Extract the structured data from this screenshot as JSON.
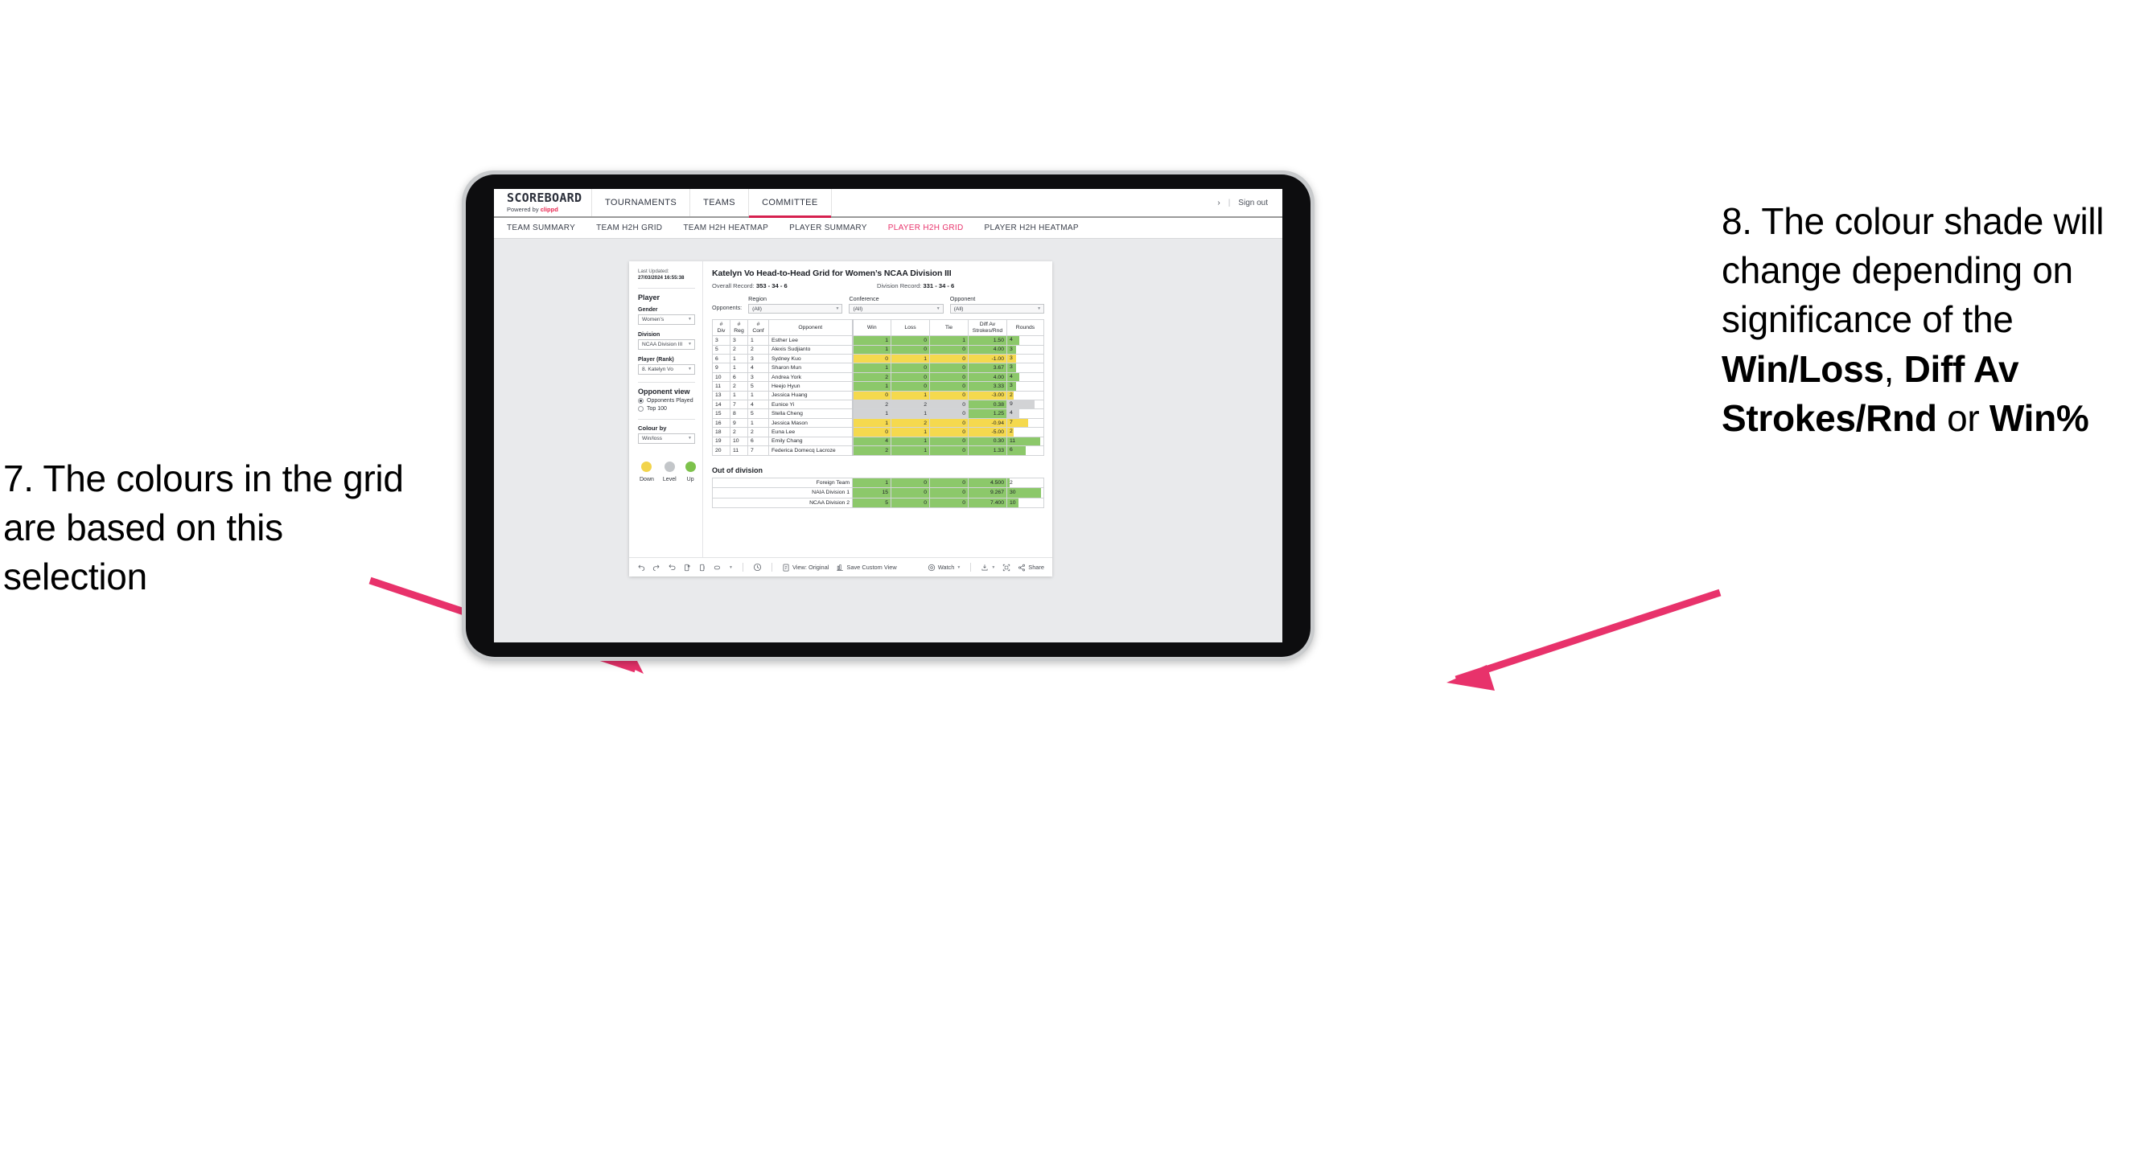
{
  "annotations": {
    "left": "7. The colours in the grid are based on this selection",
    "right_pre": "8. The colour shade will change depending on significance of the ",
    "right_b1": "Win/Loss",
    "right_mid1": ", ",
    "right_b2": "Diff Av Strokes/Rnd",
    "right_mid2": " or ",
    "right_b3": "Win%",
    "arrow_color": "#E8326B"
  },
  "app": {
    "brand": {
      "title": "SCOREBOARD",
      "powered": "Powered by",
      "by": "clippd"
    },
    "topnav": [
      {
        "label": "TOURNAMENTS",
        "active": false
      },
      {
        "label": "TEAMS",
        "active": false
      },
      {
        "label": "COMMITTEE",
        "active": true
      }
    ],
    "topright": {
      "chevron": "›",
      "divider": "|",
      "signout": "Sign out"
    },
    "subnav": [
      {
        "label": "TEAM SUMMARY",
        "active": false
      },
      {
        "label": "TEAM H2H GRID",
        "active": false
      },
      {
        "label": "TEAM H2H HEATMAP",
        "active": false
      },
      {
        "label": "PLAYER SUMMARY",
        "active": false
      },
      {
        "label": "PLAYER H2H GRID",
        "active": true
      },
      {
        "label": "PLAYER H2H HEATMAP",
        "active": false
      }
    ]
  },
  "sidebar": {
    "last_updated_label": "Last Updated:",
    "last_updated_value": "27/03/2024 16:55:38",
    "player_heading": "Player",
    "gender": {
      "label": "Gender",
      "value": "Women’s"
    },
    "division": {
      "label": "Division",
      "value": "NCAA Division III"
    },
    "player_rank": {
      "label": "Player (Rank)",
      "value": "8. Katelyn Vo"
    },
    "opponent_view": {
      "heading": "Opponent view",
      "options": [
        {
          "label": "Opponents Played",
          "selected": true
        },
        {
          "label": "Top 100",
          "selected": false
        }
      ]
    },
    "colour_by": {
      "label": "Colour by",
      "value": "Win/loss"
    },
    "legend": [
      {
        "label": "Down",
        "color": "#F2D44C"
      },
      {
        "label": "Level",
        "color": "#C3C6C9"
      },
      {
        "label": "Up",
        "color": "#7DC24B"
      }
    ]
  },
  "view": {
    "title": "Katelyn Vo Head-to-Head Grid for Women’s NCAA Division III",
    "overall_label": "Overall Record:",
    "overall_value": "353 -  34 - 6",
    "division_label": "Division Record:",
    "division_value": "331 -  34 - 6",
    "opponents_label": "Opponents:",
    "filters": [
      {
        "label": "Region",
        "value": "(All)"
      },
      {
        "label": "Conference",
        "value": "(All)"
      },
      {
        "label": "Opponent",
        "value": "(All)"
      }
    ]
  },
  "chart_data": {
    "type": "table",
    "title": "Katelyn Vo Head-to-Head Grid for Women’s NCAA Division III",
    "columns": [
      "# Div",
      "# Reg",
      "# Conf",
      "Opponent",
      "Win",
      "Loss",
      "Tie",
      "Diff Av Strokes/Rnd",
      "Rounds"
    ],
    "rounds_max": 12,
    "rows": [
      {
        "div": "3",
        "reg": "3",
        "conf": "1",
        "opponent": "Esther Lee",
        "win": "1",
        "loss": "0",
        "tie": "1",
        "diff": "1.50",
        "rounds": "4",
        "rounds_val": 4,
        "color": "green"
      },
      {
        "div": "5",
        "reg": "2",
        "conf": "2",
        "opponent": "Alexis Sudjianto",
        "win": "1",
        "loss": "0",
        "tie": "0",
        "diff": "4.00",
        "rounds": "3",
        "rounds_val": 3,
        "color": "green"
      },
      {
        "div": "6",
        "reg": "1",
        "conf": "3",
        "opponent": "Sydney Kuo",
        "win": "0",
        "loss": "1",
        "tie": "0",
        "diff": "-1.00",
        "rounds": "3",
        "rounds_val": 3,
        "color": "yellow"
      },
      {
        "div": "9",
        "reg": "1",
        "conf": "4",
        "opponent": "Sharon Mun",
        "win": "1",
        "loss": "0",
        "tie": "0",
        "diff": "3.67",
        "rounds": "3",
        "rounds_val": 3,
        "color": "green"
      },
      {
        "div": "10",
        "reg": "6",
        "conf": "3",
        "opponent": "Andrea York",
        "win": "2",
        "loss": "0",
        "tie": "0",
        "diff": "4.00",
        "rounds": "4",
        "rounds_val": 4,
        "color": "green"
      },
      {
        "div": "11",
        "reg": "2",
        "conf": "5",
        "opponent": "Heejo Hyun",
        "win": "1",
        "loss": "0",
        "tie": "0",
        "diff": "3.33",
        "rounds": "3",
        "rounds_val": 3,
        "color": "green"
      },
      {
        "div": "13",
        "reg": "1",
        "conf": "1",
        "opponent": "Jessica Huang",
        "win": "0",
        "loss": "1",
        "tie": "0",
        "diff": "-3.00",
        "rounds": "2",
        "rounds_val": 2,
        "color": "yellow"
      },
      {
        "div": "14",
        "reg": "7",
        "conf": "4",
        "opponent": "Eunice Yi",
        "win": "2",
        "loss": "2",
        "tie": "0",
        "diff": "0.38",
        "rounds": "9",
        "rounds_val": 9,
        "color": "grey",
        "diff_color": "green"
      },
      {
        "div": "15",
        "reg": "8",
        "conf": "5",
        "opponent": "Stella Cheng",
        "win": "1",
        "loss": "1",
        "tie": "0",
        "diff": "1.25",
        "rounds": "4",
        "rounds_val": 4,
        "color": "grey",
        "diff_color": "green"
      },
      {
        "div": "16",
        "reg": "9",
        "conf": "1",
        "opponent": "Jessica Mason",
        "win": "1",
        "loss": "2",
        "tie": "0",
        "diff": "-0.94",
        "rounds": "7",
        "rounds_val": 7,
        "color": "yellow"
      },
      {
        "div": "18",
        "reg": "2",
        "conf": "2",
        "opponent": "Euna Lee",
        "win": "0",
        "loss": "1",
        "tie": "0",
        "diff": "-5.00",
        "rounds": "2",
        "rounds_val": 2,
        "color": "yellow"
      },
      {
        "div": "19",
        "reg": "10",
        "conf": "6",
        "opponent": "Emily Chang",
        "win": "4",
        "loss": "1",
        "tie": "0",
        "diff": "0.30",
        "rounds": "11",
        "rounds_val": 11,
        "color": "green"
      },
      {
        "div": "20",
        "reg": "11",
        "conf": "7",
        "opponent": "Federica Domecq Lacroze",
        "win": "2",
        "loss": "1",
        "tie": "0",
        "diff": "1.33",
        "rounds": "6",
        "rounds_val": 6,
        "color": "green"
      }
    ],
    "out_of_division": {
      "title": "Out of division",
      "rows": [
        {
          "name": "Foreign Team",
          "win": "1",
          "loss": "0",
          "tie": "0",
          "diff": "4.500",
          "rounds": "2",
          "rounds_val": 2,
          "color": "green"
        },
        {
          "name": "NAIA Division 1",
          "win": "15",
          "loss": "0",
          "tie": "0",
          "diff": "9.267",
          "rounds": "30",
          "rounds_val": 30,
          "color": "green"
        },
        {
          "name": "NCAA Division 2",
          "win": "5",
          "loss": "0",
          "tie": "0",
          "diff": "7.400",
          "rounds": "10",
          "rounds_val": 10,
          "color": "green"
        }
      ],
      "rounds_max": 32
    },
    "colors": {
      "green": "#8CC86A",
      "yellow": "#F5D94E",
      "grey": "#D2D3D5"
    }
  },
  "toolbar": {
    "view_original": "View: Original",
    "save_custom_view": "Save Custom View",
    "watch": "Watch",
    "share": "Share",
    "caret": "▾"
  }
}
